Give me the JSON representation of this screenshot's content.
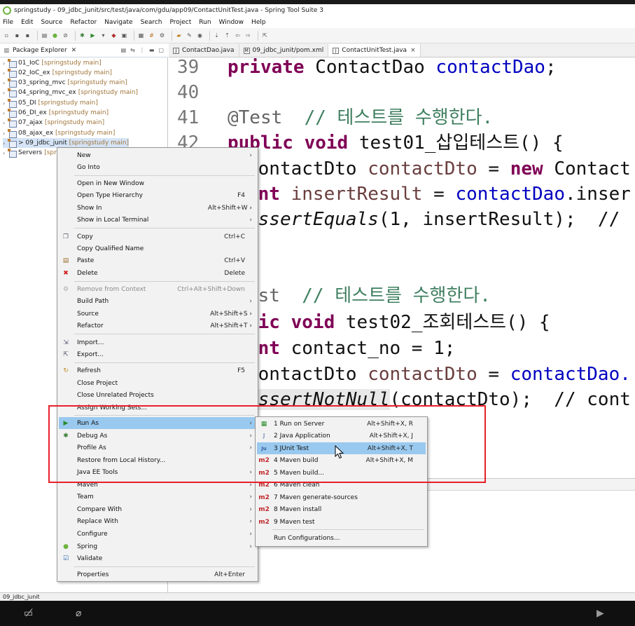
{
  "window": {
    "title": "springstudy - 09_jdbc_junit/src/test/java/com/gdu/app09/ContactUnitTest.java - Spring Tool Suite 3"
  },
  "menubar": [
    "File",
    "Edit",
    "Source",
    "Refactor",
    "Navigate",
    "Search",
    "Project",
    "Run",
    "Window",
    "Help"
  ],
  "package_explorer": {
    "tab_label": "Package Explorer",
    "items": [
      {
        "name": "01_IoC",
        "loc": "[springstudy main]"
      },
      {
        "name": "02_IoC_ex",
        "loc": "[springstudy main]"
      },
      {
        "name": "03_spring_mvc",
        "loc": "[springstudy main]"
      },
      {
        "name": "04_spring_mvc_ex",
        "loc": "[springstudy main]"
      },
      {
        "name": "05_DI",
        "loc": "[springstudy main]"
      },
      {
        "name": "06_DI_ex",
        "loc": "[springstudy main]"
      },
      {
        "name": "07_ajax",
        "loc": "[springstudy main]"
      },
      {
        "name": "08_ajax_ex",
        "loc": "[springstudy main]"
      },
      {
        "name": "> 09_jdbc_junit",
        "loc": "[springstudy main]"
      },
      {
        "name": "Servers",
        "loc": "[spr"
      }
    ]
  },
  "editor_tabs": [
    {
      "label": "ContactDao.java",
      "icon": "J"
    },
    {
      "label": "09_jdbc_junit/pom.xml",
      "icon": "M"
    },
    {
      "label": "ContactUnitTest.java",
      "icon": "J",
      "close": "×"
    }
  ],
  "code": {
    "l39": {
      "num": "39",
      "kw": "private",
      "type": " ContactDao ",
      "var": "contactDao",
      "end": ";"
    },
    "l40": {
      "num": "40"
    },
    "l41": {
      "num": "41",
      "ann": "@Test",
      "cmt": "  // 테스트를 수행한다."
    },
    "l42": {
      "num": "42",
      "kw1": "public",
      "kw2": " void",
      "rest": " test01_삽입테스트() {"
    },
    "l43": {
      "a": "ContactDto ",
      "b": "contactDto",
      "c": " = ",
      "kw": "new",
      "d": " Contact"
    },
    "l44": {
      "kw": "int",
      "a": " insertResult",
      "b": " = ",
      "var": "contactDao",
      "c": ".inser"
    },
    "l45": {
      "it": "assertEquals",
      "a": "(1, insertResult);  //"
    },
    "l46": {
      "ann": "est",
      "cmt": "  // 테스트를 수행한다."
    },
    "l47": {
      "kw1": "lic",
      "kw2": " void",
      "rest": " test02_조회테스트() {"
    },
    "l48": {
      "kw": "int",
      "a": " contact_no = 1;"
    },
    "l49": {
      "a": "ContactDto ",
      "b": "contactDto",
      "c": " = ",
      "var": "contactDao."
    },
    "l50": {
      "it": "assertNotNull",
      "a": "(contactDto);  // cont"
    }
  },
  "context_menu": {
    "items": [
      {
        "label": "New",
        "shortcut": "",
        "sub": "›"
      },
      {
        "label": "Go Into",
        "shortcut": ""
      },
      {
        "label": "Open in New Window",
        "shortcut": ""
      },
      {
        "label": "Open Type Hierarchy",
        "shortcut": "F4"
      },
      {
        "label": "Show In",
        "shortcut": "Alt+Shift+W ›"
      },
      {
        "label": "Show in Local Terminal",
        "shortcut": "",
        "sub": "›"
      },
      {
        "label": "Copy",
        "shortcut": "Ctrl+C"
      },
      {
        "label": "Copy Qualified Name",
        "shortcut": ""
      },
      {
        "label": "Paste",
        "shortcut": "Ctrl+V"
      },
      {
        "label": "Delete",
        "shortcut": "Delete"
      },
      {
        "label": "Remove from Context",
        "shortcut": "Ctrl+Alt+Shift+Down"
      },
      {
        "label": "Build Path",
        "shortcut": "",
        "sub": "›"
      },
      {
        "label": "Source",
        "shortcut": "Alt+Shift+S ›"
      },
      {
        "label": "Refactor",
        "shortcut": "Alt+Shift+T ›"
      },
      {
        "label": "Import...",
        "shortcut": ""
      },
      {
        "label": "Export...",
        "shortcut": ""
      },
      {
        "label": "Refresh",
        "shortcut": "F5"
      },
      {
        "label": "Close Project",
        "shortcut": ""
      },
      {
        "label": "Close Unrelated Projects",
        "shortcut": ""
      },
      {
        "label": "Assign Working Sets...",
        "shortcut": ""
      },
      {
        "label": "Run As",
        "shortcut": "",
        "sub": "›"
      },
      {
        "label": "Debug As",
        "shortcut": "",
        "sub": "›"
      },
      {
        "label": "Profile As",
        "shortcut": "",
        "sub": "›"
      },
      {
        "label": "Restore from Local History...",
        "shortcut": ""
      },
      {
        "label": "Java EE Tools",
        "shortcut": "",
        "sub": "›"
      },
      {
        "label": "Maven",
        "shortcut": "",
        "sub": "›"
      },
      {
        "label": "Team",
        "shortcut": "",
        "sub": "›"
      },
      {
        "label": "Compare With",
        "shortcut": "",
        "sub": "›"
      },
      {
        "label": "Replace With",
        "shortcut": "",
        "sub": "›"
      },
      {
        "label": "Configure",
        "shortcut": "",
        "sub": "›"
      },
      {
        "label": "Spring",
        "shortcut": "",
        "sub": "›"
      },
      {
        "label": "Validate",
        "shortcut": ""
      },
      {
        "label": "Properties",
        "shortcut": "Alt+Enter"
      }
    ]
  },
  "run_as_submenu": {
    "items": [
      {
        "label": "1 Run on Server",
        "shortcut": "Alt+Shift+X, R"
      },
      {
        "label": "2 Java Application",
        "shortcut": "Alt+Shift+X, J"
      },
      {
        "label": "3 JUnit Test",
        "shortcut": "Alt+Shift+X, T"
      },
      {
        "label": "4 Maven build",
        "shortcut": "Alt+Shift+X, M"
      },
      {
        "label": "5 Maven build...",
        "shortcut": ""
      },
      {
        "label": "6 Maven clean",
        "shortcut": ""
      },
      {
        "label": "7 Maven generate-sources",
        "shortcut": ""
      },
      {
        "label": "8 Maven install",
        "shortcut": ""
      },
      {
        "label": "9 Maven test",
        "shortcut": ""
      },
      {
        "label": "Run Configurations...",
        "shortcut": ""
      }
    ],
    "m2_badge": "m2"
  },
  "status_bar": {
    "text": "09_jdbc_junit"
  },
  "colors": {
    "highlight": "#99c9ef",
    "annotation_box": "#e8202a",
    "keyword": "#7f0055",
    "field": "#0000c0"
  }
}
